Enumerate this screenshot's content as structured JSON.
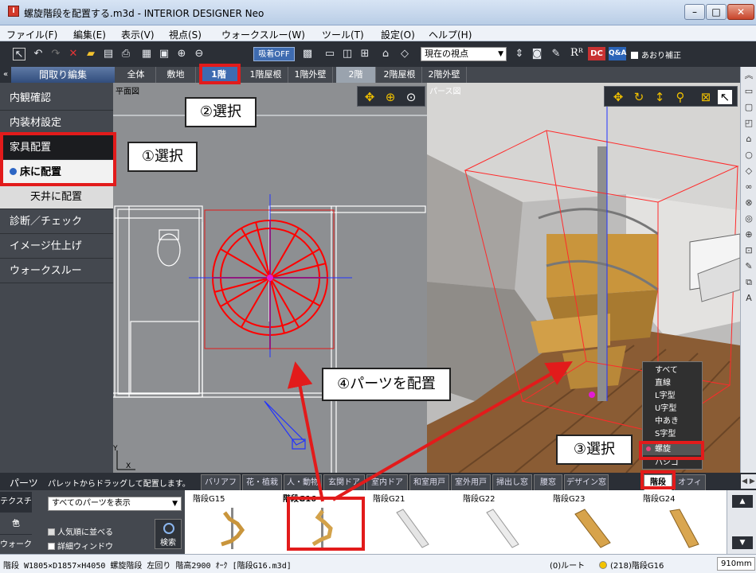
{
  "window": {
    "title": "螺旋階段を配置する.m3d - INTERIOR DESIGNER Neo",
    "app_icon": "I",
    "buttons": {
      "minimize": "–",
      "maximize": "□",
      "close": "✕"
    }
  },
  "menu": [
    "ファイル(F)",
    "編集(E)",
    "表示(V)",
    "視点(S)",
    "ウォークスルー(W)",
    "ツール(T)",
    "設定(O)",
    "ヘルプ(H)"
  ],
  "toolbar": {
    "snap_label": "吸着OFF",
    "viewpoint_value": "現在の視点",
    "r_label": "Rᴿ",
    "dc_label": "DC",
    "qa_label": "Q&A",
    "tilt_label": "あおり補正"
  },
  "tabs": {
    "collapse": "«",
    "mode_label": "間取り編集",
    "floors": [
      "全体",
      "敷地",
      "1階",
      "1階屋根",
      "1階外壁",
      "2階",
      "2階屋根",
      "2階外壁"
    ],
    "active_floor": "1階"
  },
  "left_panel": {
    "items": [
      {
        "label": "内観確認"
      },
      {
        "label": "内装材設定"
      },
      {
        "label": "家具配置"
      },
      {
        "label": "床に配置"
      },
      {
        "label": "天井に配置"
      },
      {
        "label": "診断／チェック"
      },
      {
        "label": "イメージ仕上げ"
      },
      {
        "label": "ウォークスルー"
      }
    ]
  },
  "plan_view": {
    "label": "平面図",
    "axis_y": "Y",
    "axis_x": "X"
  },
  "persp_view": {
    "label": "パース図"
  },
  "stair_menu": {
    "items": [
      "すべて",
      "直線",
      "L字型",
      "U字型",
      "中あき",
      "S字型",
      "螺旋",
      "ハシゴ"
    ],
    "selected": "螺旋"
  },
  "parts": {
    "title": "パーツ",
    "hint": "パレットからドラッグして配置します。",
    "categories": [
      "バリアフリー",
      "花・植栽",
      "人・動物",
      "玄関ドア",
      "室内ドア",
      "和室用戸",
      "室外用戸",
      "掃出し窓",
      "腰窓",
      "デザイン窓",
      "階段",
      "オフィス"
    ],
    "active_category": "階段",
    "side_tabs": [
      "テクスチャ",
      "色",
      "ウォーク"
    ],
    "filter_value": "すべてのパーツを表示",
    "check_popular": "人気順に並べる",
    "check_detail": "詳細ウィンドウ",
    "search_label": "検索",
    "items": [
      {
        "name": "階段G15",
        "style": "spiral"
      },
      {
        "name": "階段G16",
        "style": "spiral"
      },
      {
        "name": "階段G21",
        "style": "straight-white"
      },
      {
        "name": "階段G22",
        "style": "straight-white"
      },
      {
        "name": "階段G23",
        "style": "straight-wood"
      },
      {
        "name": "階段G24",
        "style": "straight-wood"
      }
    ],
    "selected_item": "階段G16"
  },
  "status": {
    "left": "階段 W1805×D1857×H4050  螺旋階段 左回り 階高2900 ｵｰｸ  [階段G16.m3d]",
    "root": "(0)ルート",
    "part": "(218)階段G16",
    "unit": "910mm"
  },
  "annotations": {
    "step1": "①選択",
    "step2": "②選択",
    "step3": "③選択",
    "step4": "④パーツを配置"
  },
  "colors": {
    "annotation_red": "#e21b1b",
    "active_tab": "#3e6bb0",
    "stair_red": "#ff0000"
  }
}
